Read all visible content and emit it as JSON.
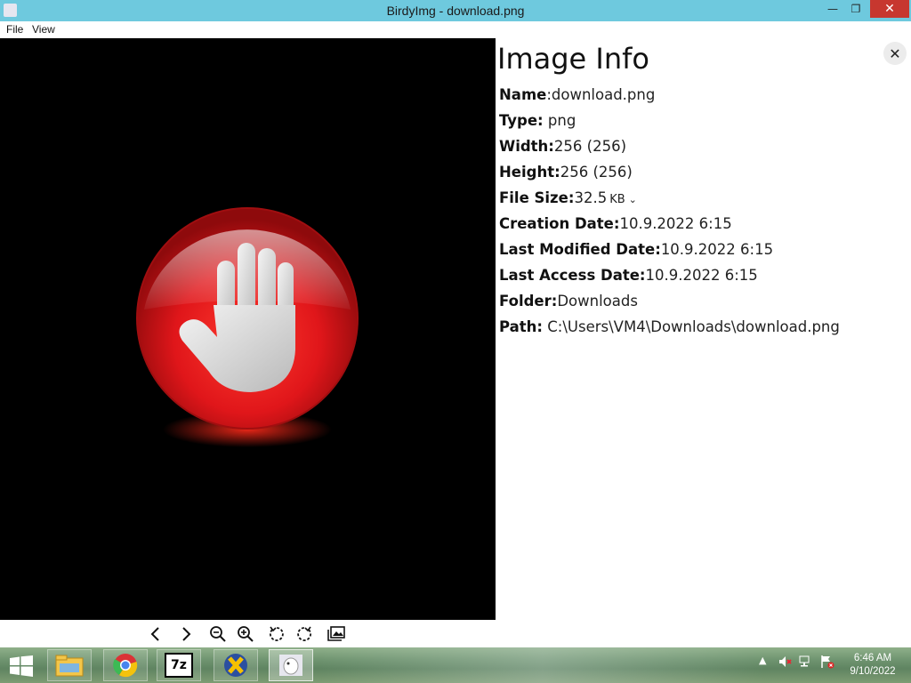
{
  "window": {
    "title": "BirdyImg - download.png",
    "minimize_glyph": "—",
    "restore_glyph": "❐",
    "close_glyph": "✕"
  },
  "menu": {
    "file": "File",
    "view": "View"
  },
  "info": {
    "heading": "Image Info",
    "close_glyph": "✕",
    "rows": {
      "name": {
        "label": "Name",
        "sep": ":",
        "value": "download.png"
      },
      "type": {
        "label": "Type:",
        "sep": " ",
        "value": "png"
      },
      "width": {
        "label": "Width:",
        "value": "256 (256)"
      },
      "height": {
        "label": "Height:",
        "value": "256 (256)"
      },
      "file_size": {
        "label": "File Size:",
        "value": "32.5",
        "unit": "KB",
        "chevron": "⌄"
      },
      "creation": {
        "label": "Creation Date:",
        "value": "10.9.2022 6:15"
      },
      "modified": {
        "label": "Last Modified Date:",
        "value": "10.9.2022 6:15"
      },
      "accessed": {
        "label": "Last Access Date:",
        "value": "10.9.2022 6:15"
      },
      "folder": {
        "label": "Folder:",
        "value": "Downloads"
      },
      "path": {
        "label": "Path:",
        "value": " C:\\Users\\VM4\\Downloads\\download.png"
      }
    }
  },
  "toolbar": {
    "icons": [
      "chevron-left-icon",
      "chevron-right-icon",
      "zoom-out-icon",
      "zoom-in-icon",
      "rotate-left-icon",
      "rotate-right-icon",
      "gallery-icon"
    ]
  },
  "taskbar": {
    "apps": [
      "file-explorer-icon",
      "chrome-icon",
      "7zip-icon",
      "xampp-icon",
      "birdyimg-icon"
    ],
    "sevenzip_label": "7z",
    "tray_up_glyph": "▲",
    "time": "6:46 AM",
    "date": "9/10/2022"
  },
  "colors": {
    "titlebar": "#6ec9de",
    "close_button": "#c7372f",
    "viewer_background": "#000000",
    "stop_sign_red": "#e0161a"
  }
}
